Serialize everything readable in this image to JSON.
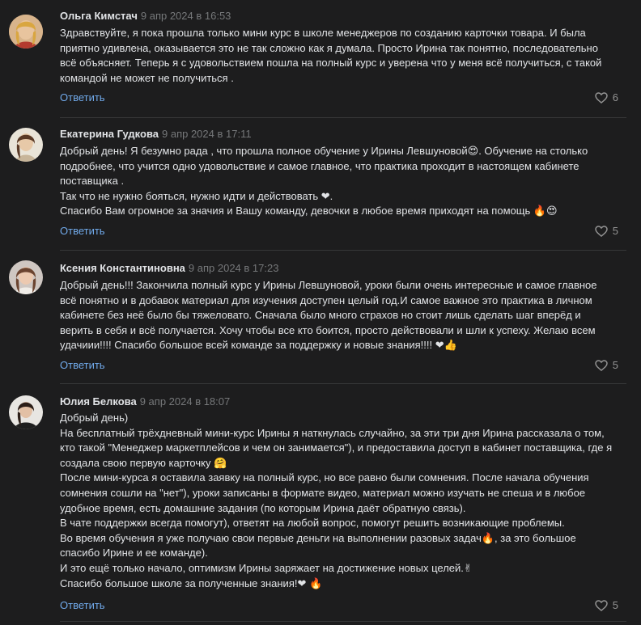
{
  "comments": [
    {
      "author": "Ольга Кимстач",
      "date": "9 апр 2024 в 16:53",
      "avatar_icon": "user-avatar-icon",
      "lines": [
        "Здравствуйте, я пока прошла только мини курс в школе менеджеров по созданию карточки товара. И была",
        "приятно удивлена, оказывается это не так сложно как я думала. Просто Ирина так понятно, последовательно",
        "всё объясняет. Теперь я с удовольствием пошла на полный курс и уверена что у меня всё получиться, с такой",
        "командой не может не получиться ."
      ],
      "reply": "Ответить",
      "likes": "6"
    },
    {
      "author": "Екатерина Гудкова",
      "date": "9 апр 2024 в 17:11",
      "avatar_icon": "user-avatar-icon",
      "lines": [
        "Добрый день! Я безумно рада , что прошла полное обучение у Ирины Левшуновой😍. Обучение на столько",
        "подробнее, что учится одно удовольствие и самое главное, что практика проходит в настоящем кабинете",
        "поставщика .",
        "Так что не нужно бояться, нужно идти и действовать ❤.",
        "Спасибо Вам огромное за значия и Вашу команду, девочки в любое время приходят на помощь 🔥😍"
      ],
      "reply": "Ответить",
      "likes": "5"
    },
    {
      "author": "Ксения Константиновна",
      "date": "9 апр 2024 в 17:23",
      "avatar_icon": "user-avatar-icon",
      "lines": [
        "Добрый день!!! Закончила полный курс у Ирины Левшуновой, уроки были очень интересные и самое главное",
        "всё понятно и в добавок материал для изучения доступен целый год.И самое важное это практика в личном",
        "кабинете без неё было бы тяжеловато. Сначала было много страхов но стоит лишь сделать шаг вперёд и",
        "верить в себя и всё получается. Хочу чтобы все кто боится, просто действовали и шли к успеху. Желаю всем",
        "удачиии!!!! Спасибо большое всей команде за поддержку и новые знания!!!! ❤👍"
      ],
      "reply": "Ответить",
      "likes": "5"
    },
    {
      "author": "Юлия Белкова",
      "date": "9 апр 2024 в 18:07",
      "avatar_icon": "user-avatar-icon",
      "lines": [
        "Добрый день)",
        "На бесплатный трёхдневный мини-курс Ирины я наткнулась случайно, за эти три дня Ирина рассказала о том,",
        "кто такой \"Менеджер маркетплейсов и чем он занимается\"), и предоставила доступ в кабинет поставщика, где я",
        "создала свою первую карточку 🤗",
        "После мини-курса я оставила заявку на полный курс, но все равно были сомнения. После начала обучения",
        "сомнения сошли на \"нет\"), уроки записаны в формате видео, материал можно изучать не спеша и в любое",
        "удобное время, есть домашние задания (по которым Ирина даёт обратную связь).",
        "В чате поддержки всегда помогут), ответят на любой вопрос, помогут решить возникающие проблемы.",
        "Во время обучения я уже получаю свои первые деньги на выполнении разовых задач🔥, за это большое",
        "спасибо Ирине и ее команде).",
        "И это ещё только начало, оптимизм Ирины заряжает на достижение новых целей.✌",
        "Спасибо большое школе за полученные знания!❤ 🔥"
      ],
      "reply": "Ответить",
      "likes": "5"
    }
  ]
}
